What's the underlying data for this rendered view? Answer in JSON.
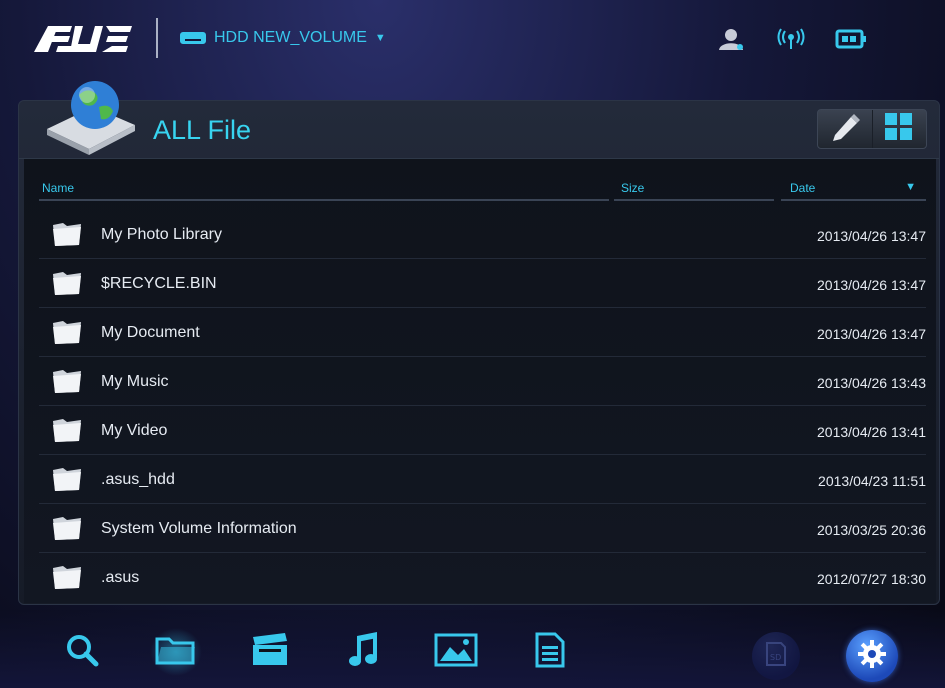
{
  "header": {
    "logo_text": "/ISUS",
    "volume_label": "HDD NEW_VOLUME",
    "icons": [
      "user-icon",
      "wifi-icon",
      "battery-icon"
    ]
  },
  "panel": {
    "title": "ALL File",
    "tools": [
      "edit-icon",
      "grid-view-icon"
    ]
  },
  "columns": {
    "name": "Name",
    "size": "Size",
    "date": "Date"
  },
  "files": [
    {
      "name": "My Photo Library",
      "date": "2013/04/26 13:47"
    },
    {
      "name": "$RECYCLE.BIN",
      "date": "2013/04/26 13:47"
    },
    {
      "name": "My Document",
      "date": "2013/04/26 13:47"
    },
    {
      "name": "My Music",
      "date": "2013/04/26 13:43"
    },
    {
      "name": "My Video",
      "date": "2013/04/26 13:41"
    },
    {
      "name": ".asus_hdd",
      "date": "2013/04/23 11:51"
    },
    {
      "name": "System Volume Information",
      "date": "2013/03/25 20:36"
    },
    {
      "name": ".asus",
      "date": "2012/07/27 18:30"
    }
  ],
  "bottom_nav": [
    "search-icon",
    "folder-icon",
    "video-icon",
    "music-icon",
    "photo-icon",
    "document-icon",
    "sd-card-icon",
    "settings-icon"
  ],
  "colors": {
    "accent": "#38c8ec",
    "background": "#15183a"
  }
}
